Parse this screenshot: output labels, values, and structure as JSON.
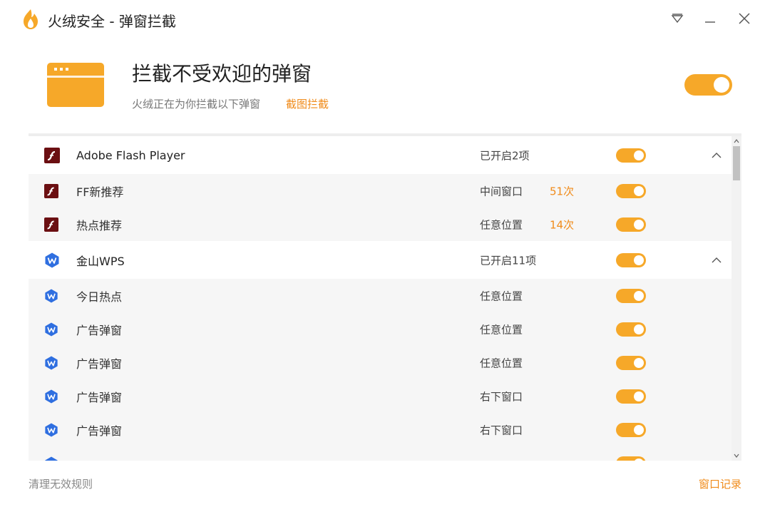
{
  "window": {
    "title": "火绒安全 - 弹窗拦截"
  },
  "header": {
    "title": "拦截不受欢迎的弹窗",
    "subtitle": "火绒正在为你拦截以下弹窗",
    "link_label": "截图拦截",
    "master_enabled": true
  },
  "groups": [
    {
      "name": "Adobe Flash Player",
      "status": "已开启2项",
      "icon": "flash-icon",
      "enabled": true,
      "expanded": true,
      "items": [
        {
          "name": "FF新推荐",
          "position": "中间窗口",
          "count": "51次",
          "enabled": true
        },
        {
          "name": "热点推荐",
          "position": "任意位置",
          "count": "14次",
          "enabled": true
        }
      ]
    },
    {
      "name": "金山WPS",
      "status": "已开启11项",
      "icon": "wps-icon",
      "enabled": true,
      "expanded": true,
      "items": [
        {
          "name": "今日热点",
          "position": "任意位置",
          "count": "",
          "enabled": true
        },
        {
          "name": "广告弹窗",
          "position": "任意位置",
          "count": "",
          "enabled": true
        },
        {
          "name": "广告弹窗",
          "position": "任意位置",
          "count": "",
          "enabled": true
        },
        {
          "name": "广告弹窗",
          "position": "右下窗口",
          "count": "",
          "enabled": true
        },
        {
          "name": "广告弹窗",
          "position": "右下窗口",
          "count": "",
          "enabled": true
        }
      ]
    }
  ],
  "footer": {
    "left_label": "清理无效规则",
    "right_label": "窗口记录"
  },
  "colors": {
    "accent": "#f6a829",
    "link": "#f08b1a",
    "flash_icon_bg": "#6b0f12",
    "wps_icon_bg": "#2f6fe0"
  }
}
